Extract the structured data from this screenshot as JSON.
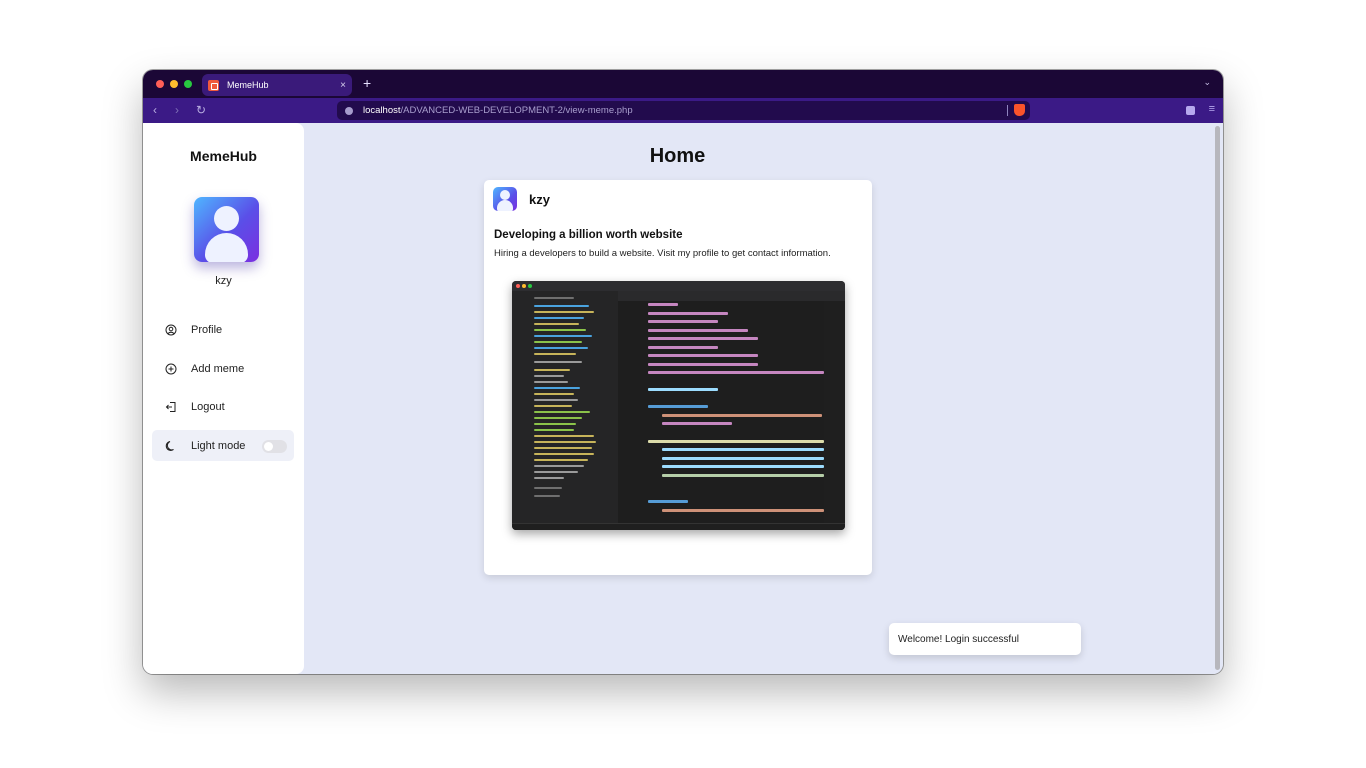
{
  "browser": {
    "tab_title": "MemeHub",
    "tab_close": "×",
    "new_tab": "+",
    "url_host": "localhost",
    "url_path": "/ADVANCED-WEB-DEVELOPMENT-2/view-meme.php"
  },
  "sidebar": {
    "brand": "MemeHub",
    "username": "kzy",
    "items": [
      {
        "label": "Profile",
        "icon": "user-circle-icon"
      },
      {
        "label": "Add meme",
        "icon": "plus-circle-icon"
      },
      {
        "label": "Logout",
        "icon": "logout-icon"
      },
      {
        "label": "Light mode",
        "icon": "moon-icon"
      }
    ],
    "light_mode_on": false
  },
  "main": {
    "title": "Home",
    "post": {
      "author": "kzy",
      "title": "Developing a billion worth website",
      "description": "Hiring a developers to build a website. Visit my profile to get contact information."
    }
  },
  "toast": {
    "message": "Welcome! Login successful"
  },
  "colors": {
    "tabbar": "#1b0736",
    "toolbar": "#3b1a86",
    "page_bg": "#e3e7f6",
    "accent_gradient_start": "#4fb6ff",
    "accent_gradient_end": "#7b2fe0"
  }
}
